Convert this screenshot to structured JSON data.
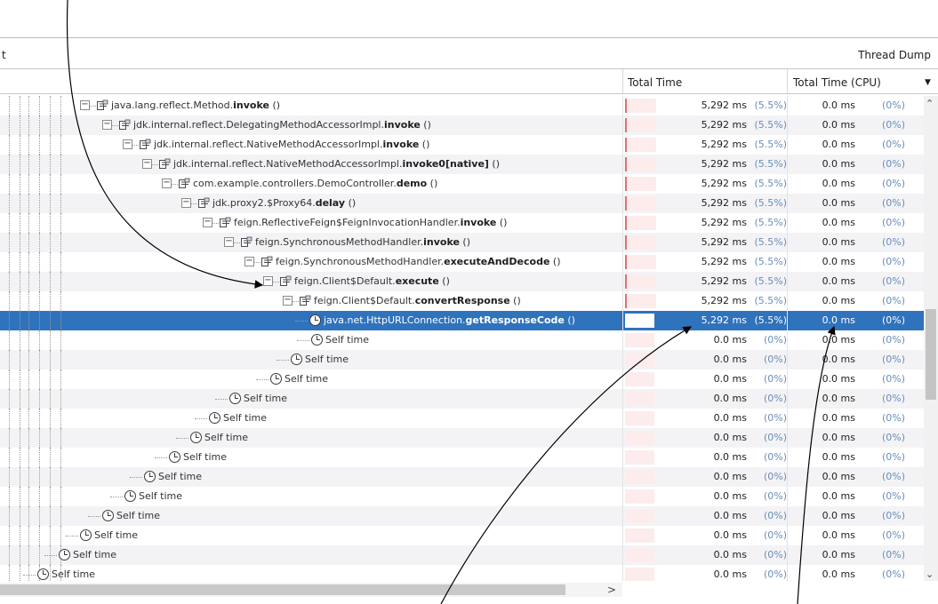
{
  "header": {
    "left_text": "t",
    "right_text": "Thread Dump"
  },
  "columns": {
    "total_time": "Total Time",
    "total_time_cpu": "Total Time (CPU)"
  },
  "rows": [
    {
      "plain": "java.lang.reflect.Method.",
      "bold": "invoke",
      "tail": " ()",
      "time": "5,292 ms",
      "tpct": "(5.5%)",
      "cpu": "0.0 ms",
      "cpct": "(0%)"
    },
    {
      "plain": "jdk.internal.reflect.DelegatingMethodAccessorImpl.",
      "bold": "invoke",
      "tail": " ()",
      "time": "5,292 ms",
      "tpct": "(5.5%)",
      "cpu": "0.0 ms",
      "cpct": "(0%)"
    },
    {
      "plain": "jdk.internal.reflect.NativeMethodAccessorImpl.",
      "bold": "invoke",
      "tail": " ()",
      "time": "5,292 ms",
      "tpct": "(5.5%)",
      "cpu": "0.0 ms",
      "cpct": "(0%)"
    },
    {
      "plain": "jdk.internal.reflect.NativeMethodAccessorImpl.",
      "bold": "invoke0[native]",
      "tail": " ()",
      "time": "5,292 ms",
      "tpct": "(5.5%)",
      "cpu": "0.0 ms",
      "cpct": "(0%)"
    },
    {
      "plain": "com.example.controllers.DemoController.",
      "bold": "demo",
      "tail": " ()",
      "time": "5,292 ms",
      "tpct": "(5.5%)",
      "cpu": "0.0 ms",
      "cpct": "(0%)"
    },
    {
      "plain": "jdk.proxy2.$Proxy64.",
      "bold": "delay",
      "tail": " ()",
      "time": "5,292 ms",
      "tpct": "(5.5%)",
      "cpu": "0.0 ms",
      "cpct": "(0%)"
    },
    {
      "plain": "feign.ReflectiveFeign$FeignInvocationHandler.",
      "bold": "invoke",
      "tail": " ()",
      "time": "5,292 ms",
      "tpct": "(5.5%)",
      "cpu": "0.0 ms",
      "cpct": "(0%)"
    },
    {
      "plain": "feign.SynchronousMethodHandler.",
      "bold": "invoke",
      "tail": " ()",
      "time": "5,292 ms",
      "tpct": "(5.5%)",
      "cpu": "0.0 ms",
      "cpct": "(0%)"
    },
    {
      "plain": "feign.SynchronousMethodHandler.",
      "bold": "executeAndDecode",
      "tail": " ()",
      "time": "5,292 ms",
      "tpct": "(5.5%)",
      "cpu": "0.0 ms",
      "cpct": "(0%)"
    },
    {
      "plain": "feign.Client$Default.",
      "bold": "execute",
      "tail": " ()",
      "time": "5,292 ms",
      "tpct": "(5.5%)",
      "cpu": "0.0 ms",
      "cpct": "(0%)"
    },
    {
      "plain": "feign.Client$Default.",
      "bold": "convertResponse",
      "tail": " ()",
      "time": "5,292 ms",
      "tpct": "(5.5%)",
      "cpu": "0.0 ms",
      "cpct": "(0%)"
    },
    {
      "plain": "java.net.HttpURLConnection.",
      "bold": "getResponseCode",
      "tail": " ()",
      "time": "5,292 ms",
      "tpct": "(5.5%)",
      "cpu": "0.0 ms",
      "cpct": "(0%)"
    },
    {
      "plain": "Self time",
      "bold": "",
      "tail": "",
      "time": "0.0 ms",
      "tpct": "(0%)",
      "cpu": "0.0 ms",
      "cpct": "(0%)"
    },
    {
      "plain": "Self time",
      "bold": "",
      "tail": "",
      "time": "0.0 ms",
      "tpct": "(0%)",
      "cpu": "0.0 ms",
      "cpct": "(0%)"
    },
    {
      "plain": "Self time",
      "bold": "",
      "tail": "",
      "time": "0.0 ms",
      "tpct": "(0%)",
      "cpu": "0.0 ms",
      "cpct": "(0%)"
    },
    {
      "plain": "Self time",
      "bold": "",
      "tail": "",
      "time": "0.0 ms",
      "tpct": "(0%)",
      "cpu": "0.0 ms",
      "cpct": "(0%)"
    },
    {
      "plain": "Self time",
      "bold": "",
      "tail": "",
      "time": "0.0 ms",
      "tpct": "(0%)",
      "cpu": "0.0 ms",
      "cpct": "(0%)"
    },
    {
      "plain": "Self time",
      "bold": "",
      "tail": "",
      "time": "0.0 ms",
      "tpct": "(0%)",
      "cpu": "0.0 ms",
      "cpct": "(0%)"
    },
    {
      "plain": "Self time",
      "bold": "",
      "tail": "",
      "time": "0.0 ms",
      "tpct": "(0%)",
      "cpu": "0.0 ms",
      "cpct": "(0%)"
    },
    {
      "plain": "Self time",
      "bold": "",
      "tail": "",
      "time": "0.0 ms",
      "tpct": "(0%)",
      "cpu": "0.0 ms",
      "cpct": "(0%)"
    },
    {
      "plain": "Self time",
      "bold": "",
      "tail": "",
      "time": "0.0 ms",
      "tpct": "(0%)",
      "cpu": "0.0 ms",
      "cpct": "(0%)"
    },
    {
      "plain": "Self time",
      "bold": "",
      "tail": "",
      "time": "0.0 ms",
      "tpct": "(0%)",
      "cpu": "0.0 ms",
      "cpct": "(0%)"
    },
    {
      "plain": "Self time",
      "bold": "",
      "tail": "",
      "time": "0.0 ms",
      "tpct": "(0%)",
      "cpu": "0.0 ms",
      "cpct": "(0%)"
    },
    {
      "plain": "Self time",
      "bold": "",
      "tail": "",
      "time": "0.0 ms",
      "tpct": "(0%)",
      "cpu": "0.0 ms",
      "cpct": "(0%)"
    },
    {
      "plain": "Self time",
      "bold": "",
      "tail": "",
      "time": "0.0 ms",
      "tpct": "(0%)",
      "cpu": "0.0 ms",
      "cpct": "(0%)"
    }
  ],
  "icons": {
    "method": "method-icon",
    "self_time": "clock-icon",
    "toggle": "collapse-toggle-icon"
  },
  "colors": {
    "selection": "#2f73bd",
    "bar_fill": "#fdecec",
    "bar_edge": "#e07070",
    "percent": "#6a8db8"
  }
}
